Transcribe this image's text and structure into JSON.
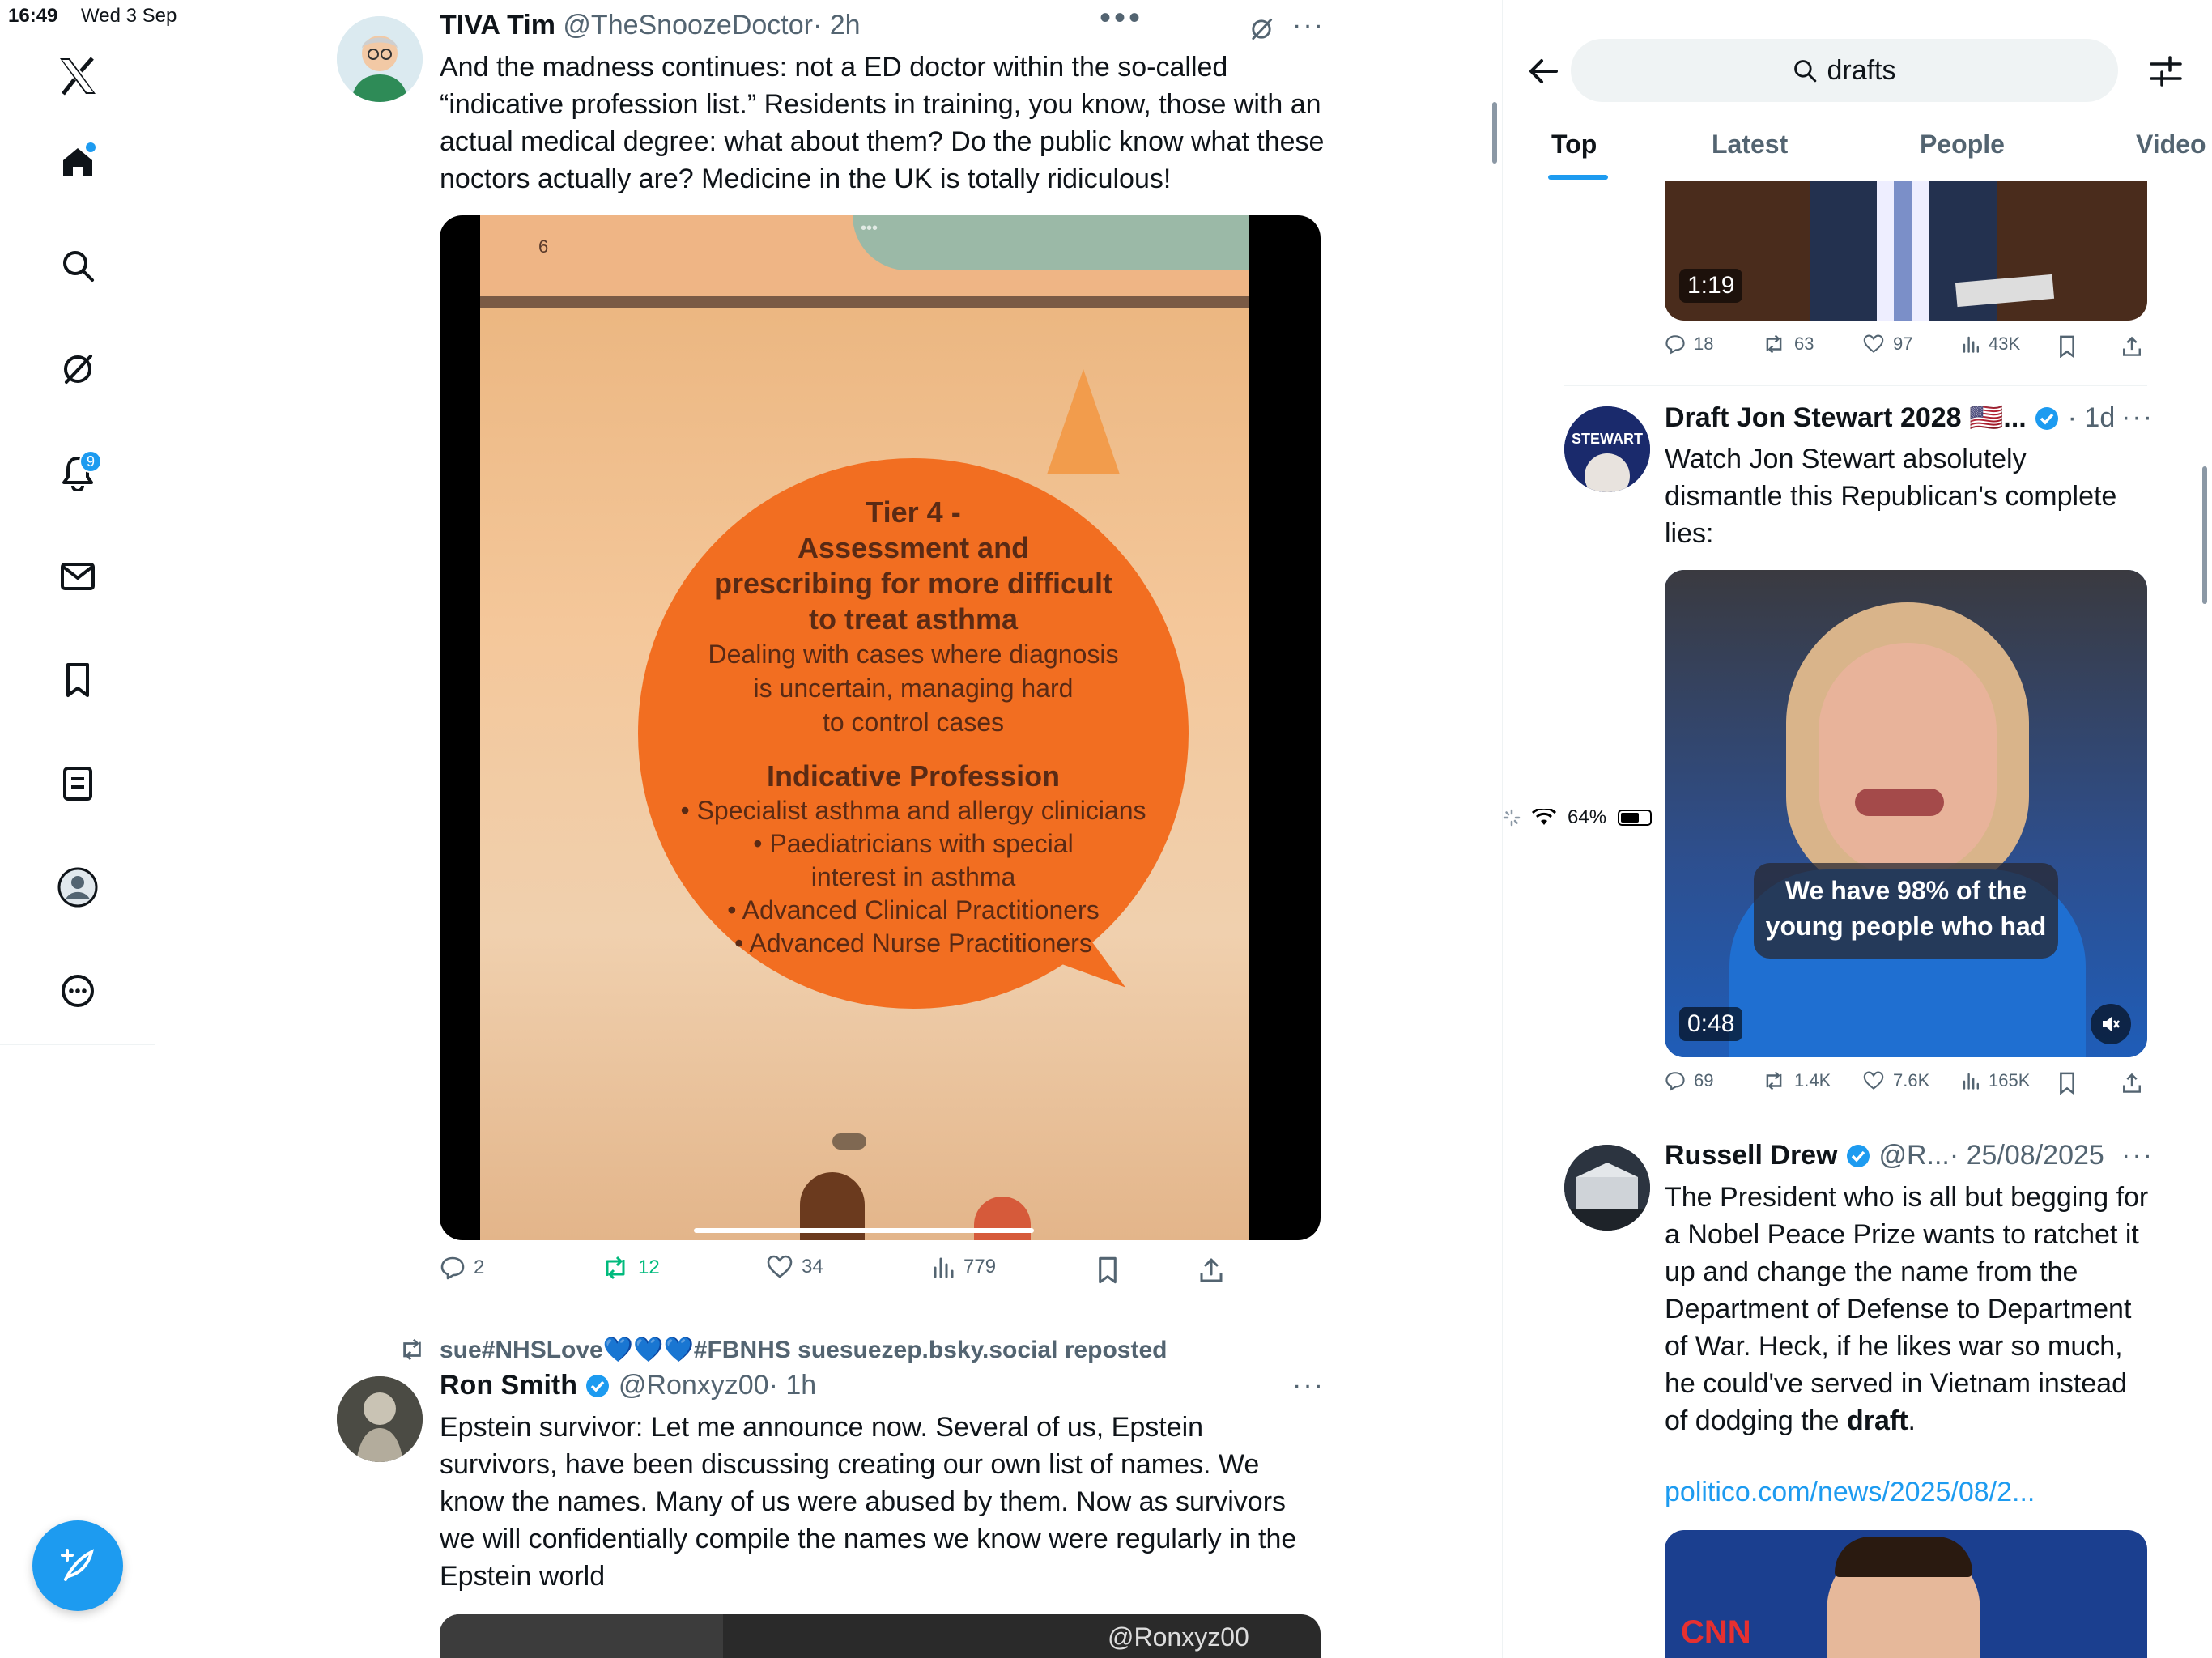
{
  "status_bar": {
    "time": "16:49",
    "date": "Wed 3 Sep",
    "battery": "64%",
    "battery_level": 0.64
  },
  "nav": {
    "notifications_badge": "9"
  },
  "main": {
    "tweets": [
      {
        "name": "TIVA Tim",
        "handle": "@TheSnoozeDoctor",
        "time": "· 2h",
        "text": "And the madness continues: not a ED doctor within the so-called “indicative profession list.” Residents in training, you know, those with an actual medical degree: what about them? Do the public know what these noctors actually are? Medicine in the UK is totally ridiculous!",
        "media": {
          "page_number": "6",
          "title_lines": [
            "Tier 4 -",
            "Assessment and",
            "prescribing for more difficult",
            "to treat asthma"
          ],
          "body_lines": [
            "Dealing with cases where diagnosis",
            "is uncertain, managing hard",
            "to control cases"
          ],
          "list_title": "Indicative Profession",
          "list_lines": [
            "• Specialist asthma and allergy clinicians",
            "• Paediatricians with special",
            "interest in asthma",
            "• Advanced Clinical Practitioners",
            "• Advanced Nurse Practitioners"
          ]
        },
        "replies": "2",
        "reposts": "12",
        "likes": "34",
        "views": "779"
      },
      {
        "repost_label": "sue#NHSLove💙💙💙#FBNHS suesuezep.bsky.social reposted",
        "name": "Ron Smith",
        "handle": "@Ronxyz00",
        "time": "· 1h",
        "text": "Epstein survivor: Let me announce now. Several of us, Epstein survivors, have been discussing creating our own list of names. We know the names. Many of us were abused by them. Now as survivors we will confidentially compile the names we know were regularly in the Epstein world",
        "media_watermark": "@Ronxyz00"
      }
    ]
  },
  "search": {
    "query": "drafts",
    "tabs": [
      "Top",
      "Latest",
      "People",
      "Video"
    ],
    "active_tab": "Top",
    "results": [
      {
        "video_duration": "1:19",
        "replies": "18",
        "reposts": "63",
        "likes": "97",
        "views": "43K"
      },
      {
        "name": "Draft Jon Stewart 2028",
        "flag": "🇺🇸",
        "ellipsis": "...",
        "time": "· 1d",
        "avatar_text": "STEWART",
        "text": "Watch Jon Stewart absolutely dismantle this Republican's complete lies:",
        "caption": "We have 98% of the young people who had",
        "video_duration": "0:48",
        "replies": "69",
        "reposts": "1.4K",
        "likes": "7.6K",
        "views": "165K"
      },
      {
        "name": "Russell Drew",
        "handle": "@R...",
        "time": "· 25/08/2025",
        "text_before": "The President who is all but begging for a Nobel Peace Prize wants to ratchet it up and change the name from the Department of Defense to Department of War. Heck, if he likes war so much, he could've served in Vietnam instead of dodging the ",
        "text_bold": "draft",
        "text_after": ".",
        "link": "politico.com/news/2025/08/2...",
        "thumb_text": "CNN"
      }
    ]
  }
}
